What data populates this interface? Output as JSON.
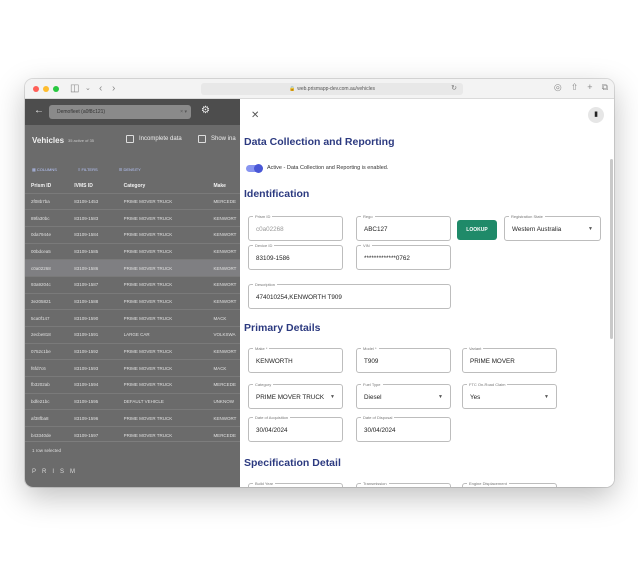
{
  "browser": {
    "url": "web.prismapp-dev.com.au/vehicles"
  },
  "left": {
    "org_selector": "Demofleet (a0f8c121)",
    "title": "Vehicles",
    "subtitle": "35 active of 35",
    "incomplete_label": "Incomplete data",
    "show_label": "Show ina",
    "toolbar": {
      "columns": "COLUMNS",
      "filters": "FILTERS",
      "density": "DENSITY"
    },
    "columns": [
      "Prism ID",
      "IVMS ID",
      "Category",
      "Make"
    ],
    "rows": [
      [
        "2f08b7ba",
        "83109-1453",
        "PRIME MOVER TRUCK",
        "MERCEDE"
      ],
      [
        "89fa30bc",
        "83109-1583",
        "PRIME MOVER TRUCK",
        "KENWORT"
      ],
      [
        "0da7944e",
        "83109-1584",
        "PRIME MOVER TRUCK",
        "KENWORT"
      ],
      [
        "00bdcea5",
        "83109-1585",
        "PRIME MOVER TRUCK",
        "KENWORT"
      ],
      [
        "c0a02268",
        "83109-1586",
        "PRIME MOVER TRUCK",
        "KENWORT"
      ],
      [
        "93a9204c",
        "83109-1587",
        "PRIME MOVER TRUCK",
        "KENWORT"
      ],
      [
        "3e205821",
        "83109-1588",
        "PRIME MOVER TRUCK",
        "KENWORT"
      ],
      [
        "5ca0f147",
        "83109-1590",
        "PRIME MOVER TRUCK",
        "MACK"
      ],
      [
        "2ecbe818",
        "83109-1591",
        "LARGE CAR",
        "VOLKSWA"
      ],
      [
        "0752c1be",
        "83109-1592",
        "PRIME MOVER TRUCK",
        "KENWORT"
      ],
      [
        "f6fd7c6",
        "83109-1593",
        "PRIME MOVER TRUCK",
        "MACK"
      ],
      [
        "fb3202ab",
        "83109-1594",
        "PRIME MOVER TRUCK",
        "MERCEDE"
      ],
      [
        "bdfe21bc",
        "83109-1595",
        "DEFAULT VEHICLE",
        "UNKNOW"
      ],
      [
        "af38fba8",
        "83109-1596",
        "PRIME MOVER TRUCK",
        "KENWORT"
      ],
      [
        "b43340de",
        "83109-1597",
        "PRIME MOVER TRUCK",
        "MERCEDE"
      ]
    ],
    "selected_row": 4,
    "footer": "1 row selected",
    "brand": "PRISM"
  },
  "panel": {
    "section_dcr": "Data Collection and Reporting",
    "toggle_label": "Active - Data Collection and Reporting is enabled.",
    "toggle_on": true,
    "section_identification": "Identification",
    "prism_id": {
      "label": "Prism ID",
      "value": "c0a02268"
    },
    "rego": {
      "label": "Rego",
      "value": "ABC127"
    },
    "lookup": "LOOKUP",
    "registration_state": {
      "label": "Registration State",
      "value": "Western Australia"
    },
    "device_id": {
      "label": "Device ID",
      "value": "83109-1586"
    },
    "vin": {
      "label": "VIN",
      "value": "*************0762"
    },
    "description": {
      "label": "Description",
      "value": "474010254,KENWORTH T909"
    },
    "section_primary": "Primary Details",
    "make": {
      "label": "Make *",
      "value": "KENWORTH"
    },
    "model": {
      "label": "Model *",
      "value": "T909"
    },
    "variant": {
      "label": "Variant",
      "value": "PRIME MOVER"
    },
    "category": {
      "label": "Category",
      "value": "PRIME MOVER TRUCK"
    },
    "fuel_type": {
      "label": "Fuel Type",
      "value": "Diesel"
    },
    "ftc": {
      "label": "FTC On-Road Claim",
      "value": "Yes"
    },
    "acquisition": {
      "label": "Date of Acquisition",
      "value": "30/04/2024"
    },
    "disposal": {
      "label": "Date of Disposal",
      "value": "30/04/2024"
    },
    "section_spec": "Specification Detail",
    "build_year": {
      "label": "Build Year"
    },
    "transmission": {
      "label": "Transmission"
    },
    "engine": {
      "label": "Engine Displacement"
    }
  },
  "colors": {
    "accent": "#2c3a80",
    "lookup": "#1f8a69",
    "toggle": "#4957d6"
  }
}
